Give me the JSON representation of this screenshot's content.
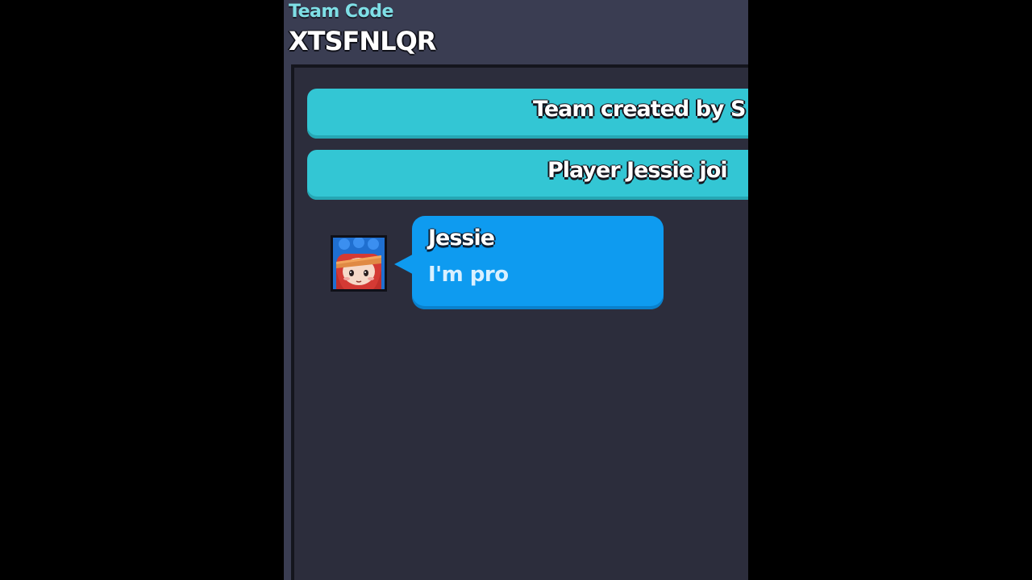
{
  "team_code": {
    "label": "Team Code",
    "value": "XTSFNLQR"
  },
  "chat": {
    "system_messages": [
      {
        "text": "Team created by S"
      },
      {
        "text": "Player Jessie joi"
      }
    ],
    "messages": [
      {
        "avatar_icon": "jessie-portrait-icon",
        "sender": "Jessie",
        "text": "I'm pro"
      }
    ]
  },
  "colors": {
    "background": "#000000",
    "panel": "#3a3d52",
    "chat_area": "#2c2d3c",
    "system_banner": "#33c6d4",
    "chat_bubble": "#0e9bf0",
    "team_code_label": "#7fdfe6"
  }
}
